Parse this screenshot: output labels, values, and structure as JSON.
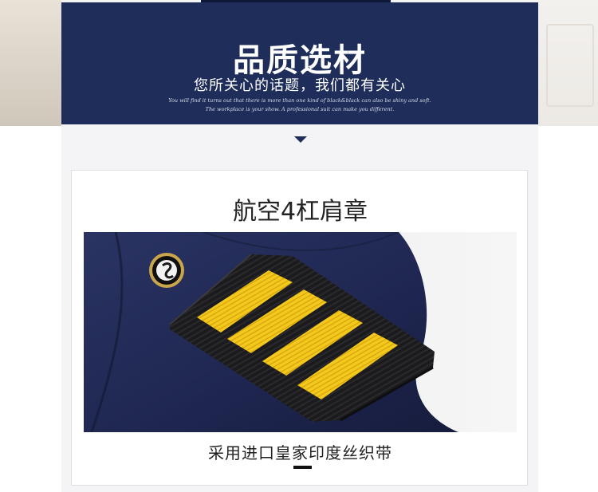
{
  "banner": {
    "title": "品质选材",
    "subtitle": "您所关心的话题，我们都有关心",
    "tagline_1": "You will find it turns out that there is more than one kind of black&black can also be shiny and soft.",
    "tagline_2": "The workplace is your show. A professional suit can make you different."
  },
  "feature": {
    "title": "航空4杠肩章",
    "caption": "采用进口皇家印度丝织带",
    "image": "epaulette-photo"
  },
  "colors": {
    "banner": "#1e2d5a",
    "stripe_gold": "#f2c81e",
    "uniform_navy": "#1c2346"
  }
}
